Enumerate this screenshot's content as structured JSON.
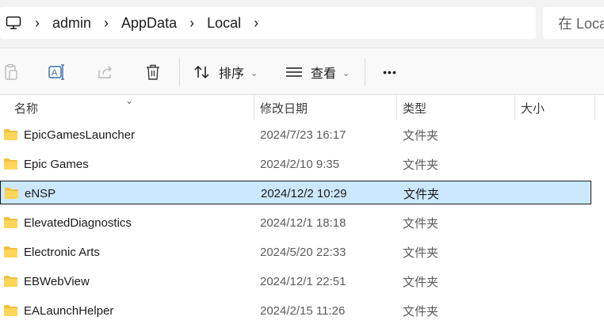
{
  "address": {
    "root_icon": "computer-icon",
    "crumbs": [
      "admin",
      "AppData",
      "Local"
    ],
    "search_placeholder": "在 Local"
  },
  "toolbar": {
    "sort_label": "排序",
    "view_label": "查看",
    "more_label": "•••"
  },
  "columns": {
    "name": "名称",
    "date": "修改日期",
    "type": "类型",
    "size": "大小"
  },
  "files": [
    {
      "name": "EpicGamesLauncher",
      "date": "2024/7/23 16:17",
      "type": "文件夹",
      "selected": false
    },
    {
      "name": "Epic Games",
      "date": "2024/2/10 9:35",
      "type": "文件夹",
      "selected": false
    },
    {
      "name": "eNSP",
      "date": "2024/12/2 10:29",
      "type": "文件夹",
      "selected": true
    },
    {
      "name": "ElevatedDiagnostics",
      "date": "2024/12/1 18:18",
      "type": "文件夹",
      "selected": false
    },
    {
      "name": "Electronic Arts",
      "date": "2024/5/20 22:33",
      "type": "文件夹",
      "selected": false
    },
    {
      "name": "EBWebView",
      "date": "2024/12/1 22:51",
      "type": "文件夹",
      "selected": false
    },
    {
      "name": "EALaunchHelper",
      "date": "2024/2/15 11:26",
      "type": "文件夹",
      "selected": false
    }
  ],
  "colors": {
    "selection": "#cce8ff",
    "folder": "#f3c03f",
    "accent": "#0a59c3"
  }
}
